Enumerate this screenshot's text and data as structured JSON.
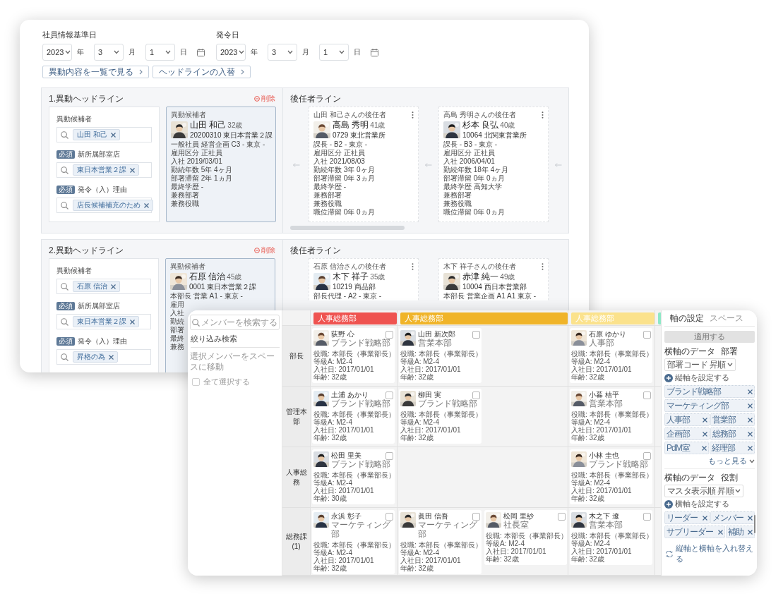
{
  "back_window": {
    "dates": [
      {
        "label": "社員情報基準日",
        "year": "2023",
        "year_unit": "年",
        "month": "3",
        "month_unit": "月",
        "day": "1",
        "day_unit": "日"
      },
      {
        "label": "発令日",
        "year": "2023",
        "year_unit": "年",
        "month": "3",
        "month_unit": "月",
        "day": "1",
        "day_unit": "日"
      }
    ],
    "buttons": [
      "異動内容を一覧で見る",
      "ヘッドラインの入替"
    ],
    "headlines": [
      {
        "title": "1.異動ヘッドライン",
        "delete_label": "削除",
        "fields": [
          {
            "label": "異動候補者",
            "chip": "山田 和己"
          },
          {
            "badge": "必須",
            "label": "新所属部室店",
            "chip": "東日本営業２課"
          },
          {
            "badge": "必須",
            "label": "発令（入）理由",
            "chip": "店長候補補充のため"
          }
        ],
        "candidate": {
          "caption": "異動候補者",
          "name": "山田 和己",
          "age": "32歳",
          "code_dept": "20200310 東日本営業２課",
          "lines": [
            "一般社員 経営企画 C3 - 東京 -",
            "雇用区分 正社員",
            "入社 2019/03/01",
            "勤続年数 5年 4ヶ月",
            "部署滞留 2年 1ヵ月",
            "最終学歴 -",
            "兼務部署",
            "兼務役職"
          ]
        },
        "successor_title": "後任者ライン",
        "successors": [
          {
            "caption": "山田 和己さんの後任者",
            "name": "高島 秀明",
            "age": "41歳",
            "code_dept": "0729 東北営業所",
            "lines": [
              "課長 - B2 - 東京 -",
              "雇用区分 正社員",
              "入社 2021/08/03",
              "勤続年数 3年 0ヶ月",
              "部署滞留 0年 3ヵ月",
              "最終学歴 -",
              "兼務部署",
              "兼務役職",
              "職位滞留 0年 0ヵ月"
            ]
          },
          {
            "caption": "高島 秀明さんの後任者",
            "name": "杉本 良弘",
            "age": "40歳",
            "code_dept": "10064 北関東営業所",
            "lines": [
              "課長 - B3 - 東京 -",
              "雇用区分 正社員",
              "入社 2006/04/01",
              "勤続年数 18年 4ヶ月",
              "部署滞留 0年 0ヵ月",
              "最終学歴 高知大学",
              "兼務部署",
              "兼務役職",
              "職位滞留 0年 0ヵ月"
            ]
          }
        ]
      },
      {
        "title": "2.異動ヘッドライン",
        "delete_label": "削除",
        "fields": [
          {
            "label": "異動候補者",
            "chip": "石原 信治"
          },
          {
            "badge": "必須",
            "label": "新所属部室店",
            "chip": "東日本営業２課"
          },
          {
            "badge": "必須",
            "label": "発令（入）理由",
            "chip": "昇格の為"
          }
        ],
        "candidate": {
          "caption": "異動候補者",
          "name": "石原 信治",
          "age": "45歳",
          "code_dept": "0001 東日本営業２課",
          "lines": [
            "本部長 営業 A1 - 東京 -",
            "雇用",
            "入社",
            "勤続",
            "部署",
            "最終",
            "兼務"
          ]
        },
        "successor_title": "後任者ライン",
        "successors": [
          {
            "caption": "石原 信治さんの後任者",
            "name": "木下 祥子",
            "age": "35歳",
            "code_dept": "10219 商品部",
            "lines": [
              "部長代理 - A2 - 東京 -"
            ]
          },
          {
            "caption": "木下 祥子さんの後任者",
            "name": "赤津 純一",
            "age": "49歳",
            "code_dept": "10004 西日本営業部",
            "lines": [
              "本部長 営業企画 A1 A1 東京 -"
            ]
          }
        ]
      }
    ]
  },
  "front_window": {
    "sidebar": {
      "search_placeholder": "メンバーを検索する",
      "filter_label": "絞り込み検索",
      "move_label": "選択メンバーをスペースに移動",
      "select_all_label": "全て選択する",
      "select_all_checked": false,
      "disabled": true
    },
    "board": {
      "columns": [
        {
          "label": "人事総務部",
          "color": "#ef5350",
          "kind": "narrow"
        },
        {
          "label": "人事総務部",
          "color": "#f0b429",
          "kind": "wide"
        },
        {
          "label": "人事総務部",
          "color": "#fbe28c",
          "kind": "narrow"
        },
        {
          "color": "#8ee8c6",
          "kind": "sliver"
        }
      ],
      "rows": [
        {
          "label": "部長",
          "cells": [
            {
              "cards": [
                {
                  "name": "荻野 心",
                  "dept": "ブランド戦略部",
                  "lines": [
                    "役職: 本部長（事業部長）",
                    "等級A: M2-4",
                    "入社日: 2017/01/01",
                    "年齢: 32歳"
                  ],
                  "checked": false
                }
              ]
            },
            {
              "cards": [
                {
                  "name": "山田 新次郎",
                  "dept": "営業本部",
                  "lines": [
                    "役職: 本部長（事業部長）",
                    "等級A: M2-4",
                    "入社日: 2017/01/01",
                    "年齢: 32歳"
                  ],
                  "checked": false
                }
              ]
            },
            {
              "cards": [
                {
                  "name": "石原 ゆかり",
                  "dept": "人事部",
                  "lines": [
                    "役職: 本部長（事業部長）",
                    "等級A: M2-4",
                    "入社日: 2017/01/01",
                    "年齢: 32歳"
                  ],
                  "checked": false
                }
              ]
            }
          ]
        },
        {
          "label": "管理本部",
          "cells": [
            {
              "cards": [
                {
                  "name": "土浦 あかり",
                  "dept": "ブランド戦略部",
                  "lines": [
                    "役職: 本部長（事業部長）",
                    "等級A: M2-4",
                    "入社日: 2017/01/01",
                    "年齢: 32歳"
                  ],
                  "checked": false
                }
              ]
            },
            {
              "cards": [
                {
                  "name": "柳田 実",
                  "dept": "ブランド戦略部",
                  "lines": [
                    "役職: 本部長（事業部長）",
                    "等級A: M2-4",
                    "入社日: 2017/01/01",
                    "年齢: 32歳"
                  ],
                  "checked": false
                }
              ]
            },
            {
              "cards": [
                {
                  "name": "小暮 桔平",
                  "dept": "営業本部",
                  "lines": [
                    "役職: 本部長（事業部長）",
                    "等級A: M2-4",
                    "入社日: 2017/01/01",
                    "年齢: 32歳"
                  ],
                  "checked": false
                }
              ]
            }
          ]
        },
        {
          "label": "人事総務",
          "cells": [
            {
              "cards": [
                {
                  "name": "松田 里美",
                  "dept": "ブランド戦略部",
                  "lines": [
                    "役職: 本部長（事業部長）",
                    "等級A: M2-4",
                    "入社日: 2017/01/01",
                    "年齢: 30歳"
                  ],
                  "checked": false
                }
              ]
            },
            {},
            {
              "cards": [
                {
                  "name": "小林 圭也",
                  "dept": "ブランド戦略部",
                  "lines": [
                    "役職: 本部長（事業部長）",
                    "等級A: M2-4",
                    "入社日: 2017/01/01",
                    "年齢: 32歳"
                  ],
                  "checked": false
                }
              ]
            }
          ]
        },
        {
          "label": "総務課 (1)",
          "cells": [
            {
              "cards": [
                {
                  "name": "永浜 彰子",
                  "dept": "マーケティング部",
                  "lines": [
                    "役職: 本部長（事業部長）",
                    "等級A: M2-4",
                    "入社日: 2017/01/01",
                    "年齢: 32歳"
                  ],
                  "checked": false
                }
              ]
            },
            {
              "cards": [
                {
                  "name": "眞田 信吾",
                  "dept": "マーケティング部",
                  "lines": [
                    "役職: 本部長（事業部長）",
                    "等級A: M2-4",
                    "入社日: 2017/01/01",
                    "年齢: 32歳"
                  ],
                  "checked": false
                },
                {
                  "name": "松岡 里紗",
                  "dept": "社長室",
                  "lines": [
                    "役職: 本部長（事業部長）",
                    "等級A: M2-4",
                    "入社日: 2017/01/01",
                    "年齢: 32歳"
                  ],
                  "checked": false
                }
              ]
            },
            {
              "cards": [
                {
                  "name": "木之下 遼",
                  "dept": "営業本部",
                  "lines": [
                    "役職: 本部長（事業部長）",
                    "等級A: M2-4",
                    "入社日: 2017/01/01",
                    "年齢: 32歳"
                  ],
                  "checked": false
                }
              ]
            }
          ]
        }
      ]
    },
    "settings": {
      "tabs": [
        {
          "label": "軸の設定",
          "selected": true
        },
        {
          "label": "スペース",
          "selected": false
        }
      ],
      "apply": {
        "label": "適用する",
        "disabled": true
      },
      "axes": [
        {
          "title": "横軸のデータ",
          "field": "部署",
          "sort": "部署コード 昇順",
          "add_label": "縦軸を設定する",
          "chips": [
            "ブランド戦略部",
            "マーケティング部",
            "人事部",
            "営業部",
            "企画部",
            "総務部",
            "PdM室",
            "経理部"
          ],
          "more_label": "もっと見る"
        },
        {
          "title": "横軸のデータ",
          "field": "役割",
          "sort": "マスタ表示順 昇順",
          "add_label": "横軸を設定する",
          "chips": [
            "リーダー",
            "メンバー",
            "サブリーダー",
            "補助"
          ]
        }
      ],
      "swap_label": "縦軸と横軸を入れ替える"
    }
  }
}
